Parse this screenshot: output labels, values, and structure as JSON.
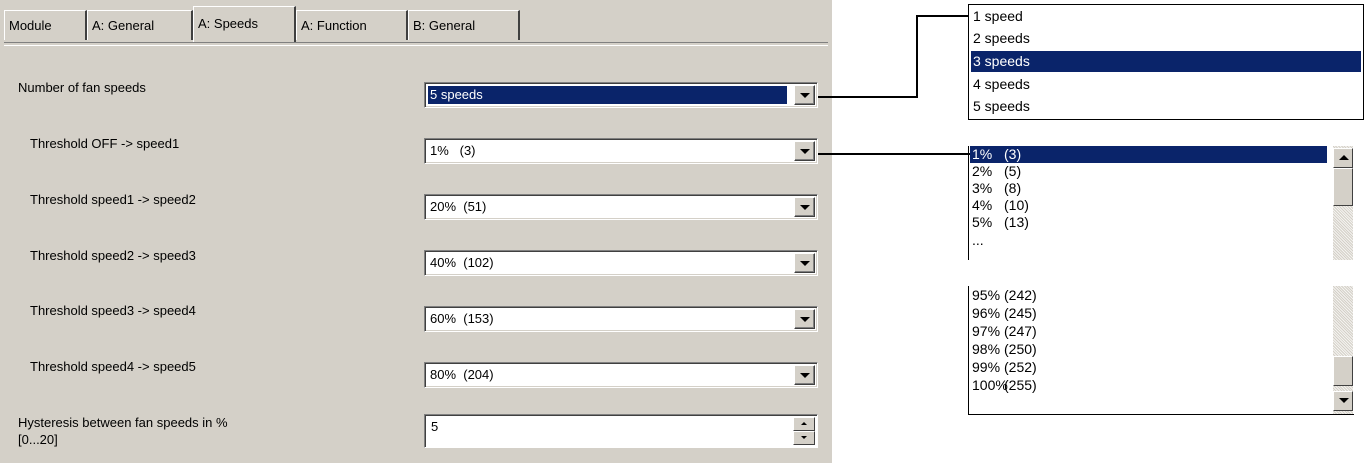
{
  "tabs": [
    {
      "label": "Module"
    },
    {
      "label": "A: General"
    },
    {
      "label": "A: Speeds",
      "active": true
    },
    {
      "label": "A: Function"
    },
    {
      "label": "B: General"
    }
  ],
  "fields": {
    "fan_speeds": {
      "label": "Number of fan speeds",
      "value": "5 speeds"
    },
    "th_off_1": {
      "label": "Threshold OFF -> speed1",
      "value": "1%   (3)"
    },
    "th_1_2": {
      "label": "Threshold speed1 -> speed2",
      "value": "20%  (51)"
    },
    "th_2_3": {
      "label": "Threshold speed2 -> speed3",
      "value": "40%  (102)"
    },
    "th_3_4": {
      "label": "Threshold speed3 -> speed4",
      "value": "60%  (153)"
    },
    "th_4_5": {
      "label": "Threshold speed4 -> speed5",
      "value": "80%  (204)"
    },
    "hysteresis": {
      "label_line1": "Hysteresis between fan speeds in %",
      "label_line2": "[0...20]",
      "value": "5"
    }
  },
  "speeds_popup": {
    "items": [
      "1 speed",
      "2 speeds",
      "3 speeds",
      "4 speeds",
      "5 speeds"
    ],
    "selected": "3 speeds"
  },
  "threshold_popup": {
    "top_items": [
      {
        "pct": "1%",
        "raw": "(3)"
      },
      {
        "pct": "2%",
        "raw": "(5)"
      },
      {
        "pct": "3%",
        "raw": "(8)"
      },
      {
        "pct": "4%",
        "raw": "(10)"
      },
      {
        "pct": "5%",
        "raw": "(13)"
      }
    ],
    "ellipsis": "...",
    "bottom_items": [
      {
        "pct": "95%",
        "raw": "(242)"
      },
      {
        "pct": "96%",
        "raw": "(245)"
      },
      {
        "pct": "97%",
        "raw": "(247)"
      },
      {
        "pct": "98%",
        "raw": "(250)"
      },
      {
        "pct": "99%",
        "raw": "(252)"
      },
      {
        "pct": "100%",
        "raw": "(255)"
      }
    ],
    "selected": "1%"
  },
  "colors": {
    "selection": "#0a246a",
    "panel": "#d4d0c8"
  }
}
